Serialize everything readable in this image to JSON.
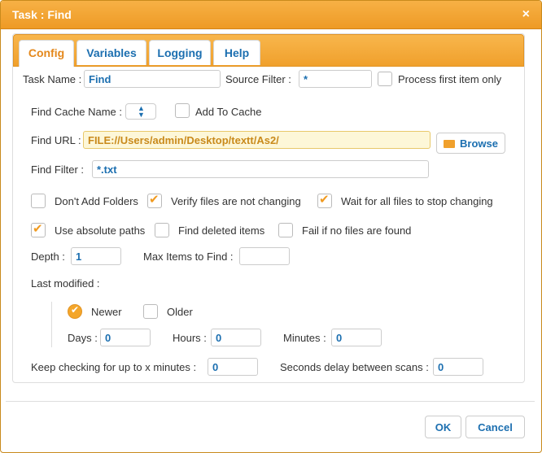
{
  "window": {
    "title": "Task : Find",
    "close_glyph": "×"
  },
  "tabs": [
    {
      "label": "Config",
      "active": true
    },
    {
      "label": "Variables",
      "active": false
    },
    {
      "label": "Logging",
      "active": false
    },
    {
      "label": "Help",
      "active": false
    }
  ],
  "form": {
    "task_name_label": "Task Name :",
    "task_name_value": "Find",
    "source_filter_label": "Source Filter :",
    "source_filter_value": "*",
    "process_first_label": "Process first item only",
    "process_first_checked": false,
    "find_cache_name_label": "Find Cache Name :",
    "add_to_cache_label": "Add To Cache",
    "add_to_cache_checked": false,
    "find_url_label": "Find URL :",
    "find_url_value": "FILE://Users/admin/Desktop/textt/As2/",
    "browse_label": "Browse",
    "find_filter_label": "Find Filter :",
    "find_filter_value": "*.txt",
    "dont_add_folders_label": "Don't Add Folders",
    "dont_add_folders_checked": false,
    "verify_files_label": "Verify files are not changing",
    "verify_files_checked": true,
    "wait_all_files_label": "Wait for all files to stop changing",
    "wait_all_files_checked": true,
    "use_absolute_paths_label": "Use absolute paths",
    "use_absolute_paths_checked": true,
    "find_deleted_label": "Find deleted items",
    "find_deleted_checked": false,
    "fail_if_none_label": "Fail if no files are found",
    "fail_if_none_checked": false,
    "depth_label": "Depth :",
    "depth_value": "1",
    "max_items_label": "Max Items to Find :",
    "max_items_value": "",
    "last_modified_label": "Last modified :",
    "newer_label": "Newer",
    "newer_selected": true,
    "older_label": "Older",
    "older_selected": false,
    "days_label": "Days :",
    "days_value": "0",
    "hours_label": "Hours :",
    "hours_value": "0",
    "minutes_label": "Minutes :",
    "minutes_value": "0",
    "keep_checking_label": "Keep checking for up to x minutes :",
    "keep_checking_value": "0",
    "seconds_delay_label": "Seconds delay between scans :",
    "seconds_delay_value": "0",
    "check_glyph": "✔"
  },
  "footer": {
    "ok_label": "OK",
    "cancel_label": "Cancel"
  },
  "colors": {
    "accent": "#f0a02c",
    "link": "#1c6fb0"
  }
}
